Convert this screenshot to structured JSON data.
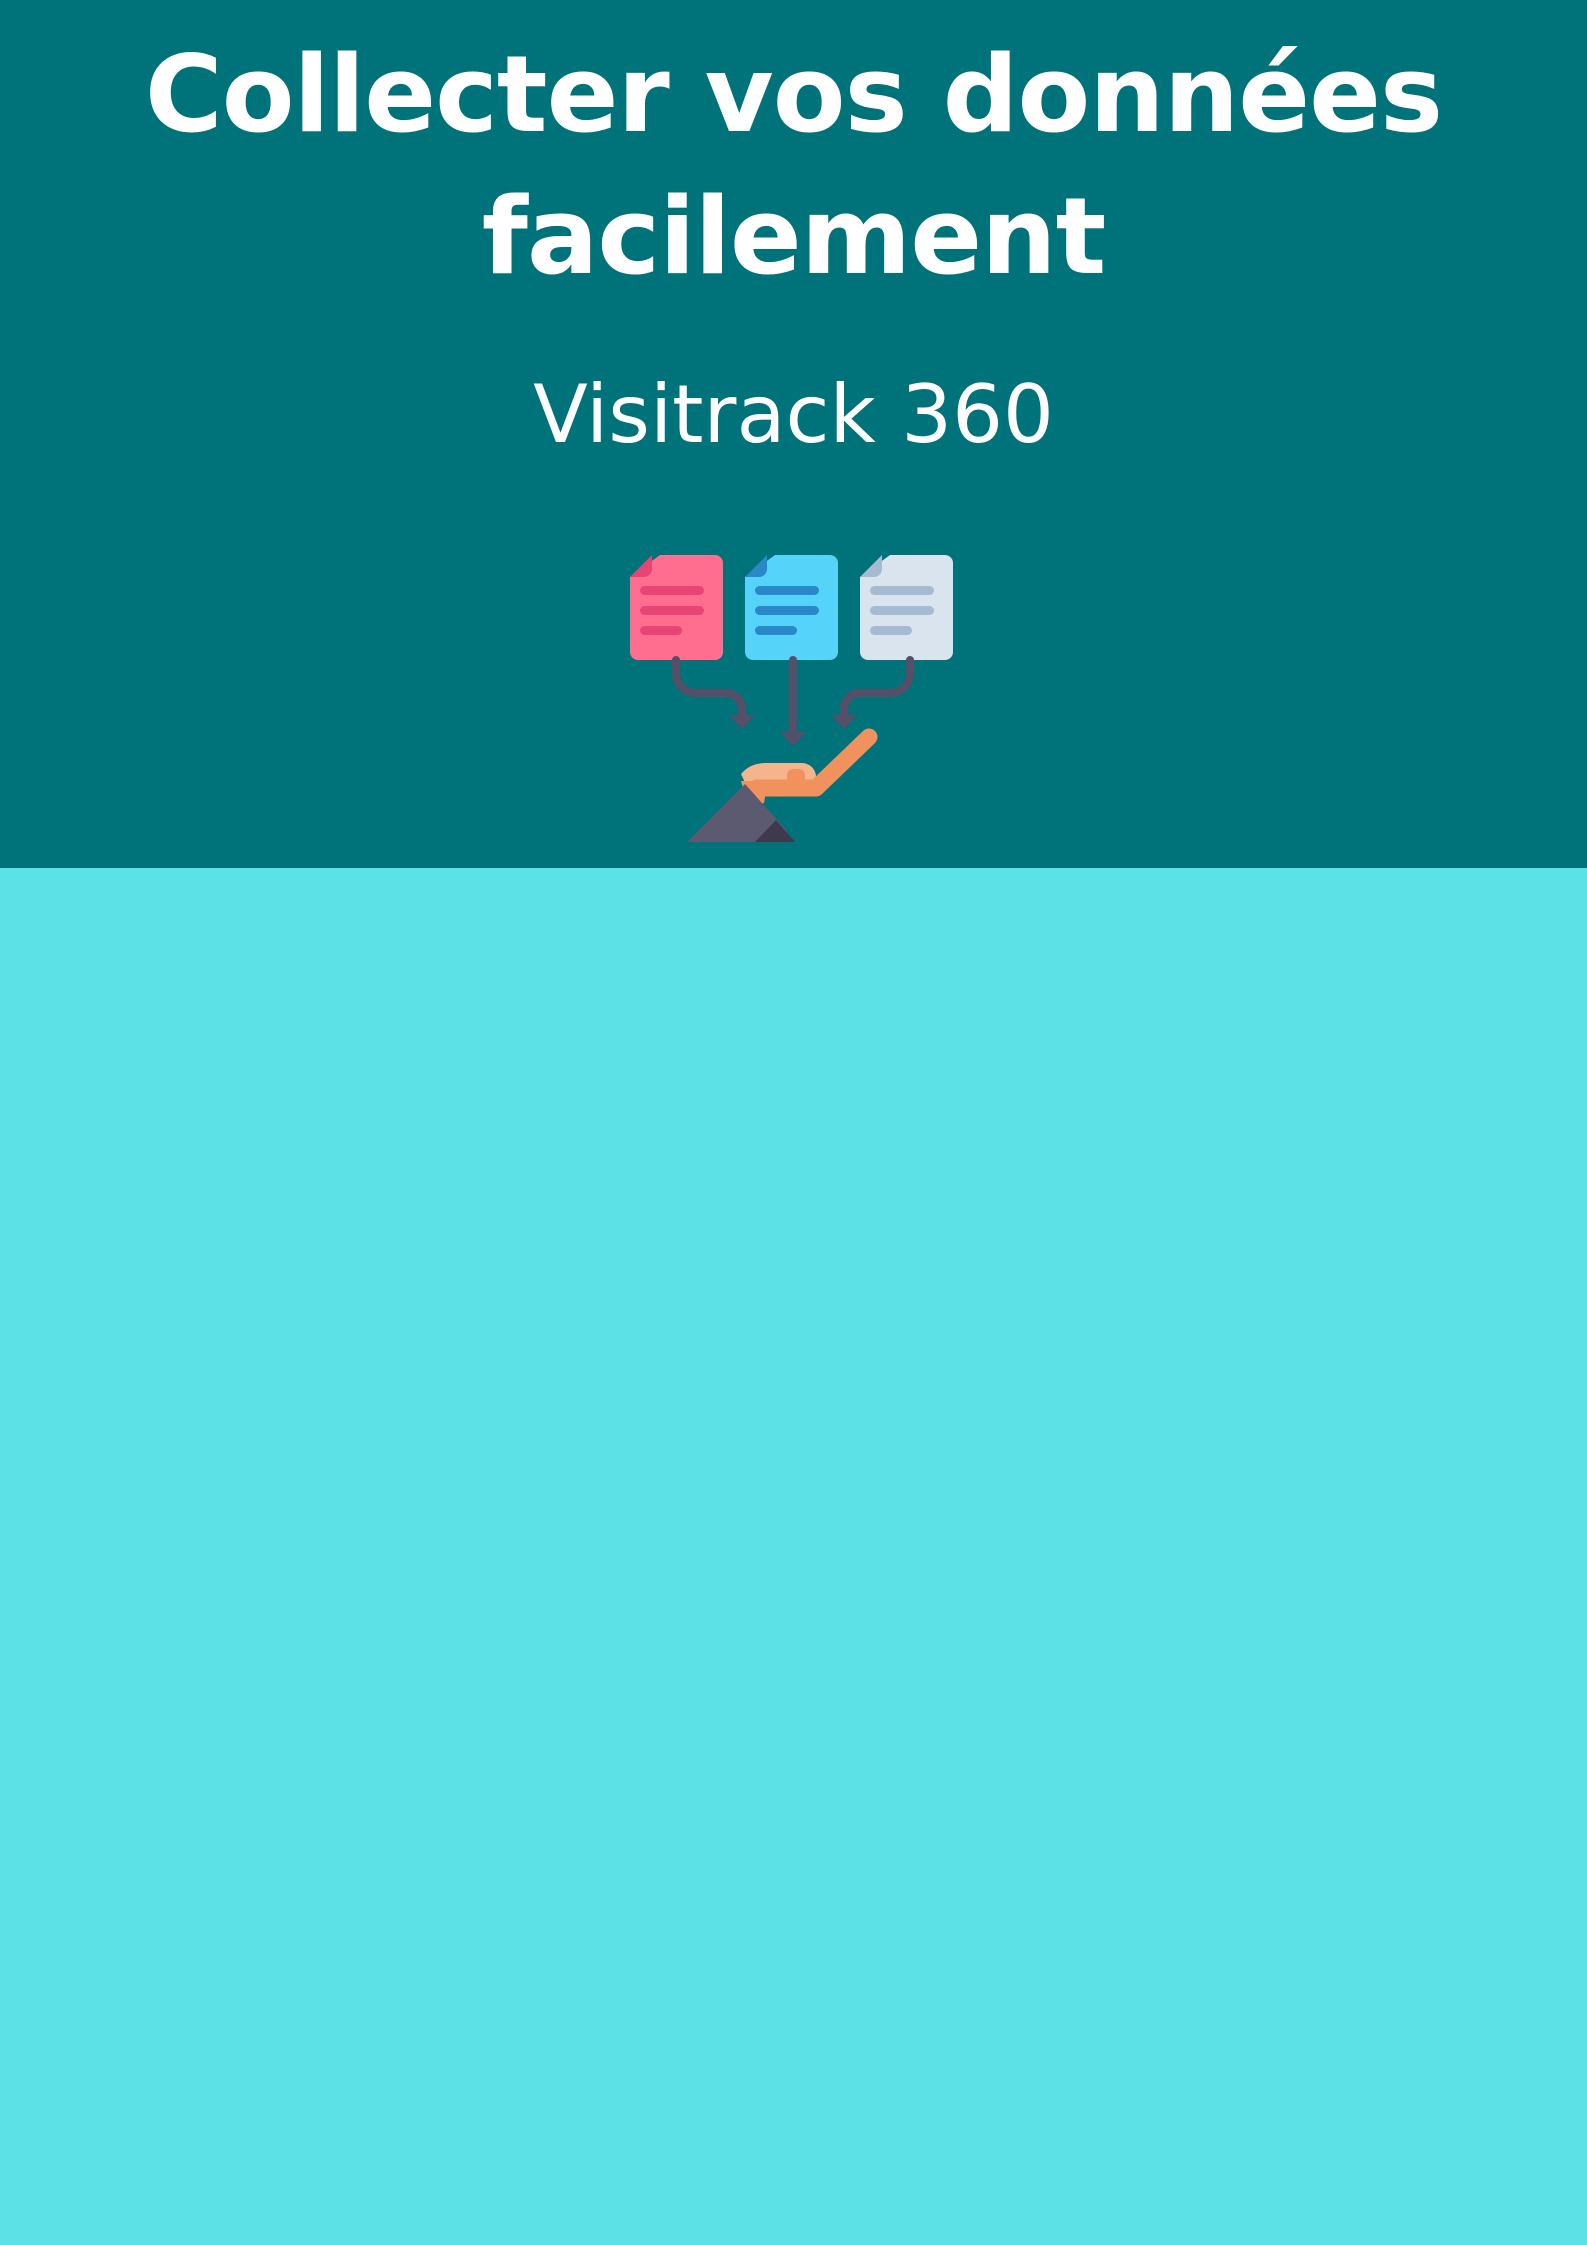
{
  "document": {
    "title_line_1": "Collecter vos données",
    "title_line_2": "facilement",
    "subtitle": "Visitrack 360"
  },
  "colors": {
    "header_background": "#00737a",
    "body_background": "#5ce1e6",
    "text": "#ffffff",
    "doc_pink": "#ff6d8f",
    "doc_blue": "#56d3f9",
    "doc_gray": "#d9e4ee",
    "arrow": "#555067",
    "hand_skin": "#f6b48c",
    "hand_orange": "#f0915e"
  },
  "illustration": {
    "icons": [
      "document-pink-icon",
      "document-blue-icon",
      "document-gray-icon",
      "merge-arrows-icon",
      "receiving-hand-icon"
    ]
  }
}
